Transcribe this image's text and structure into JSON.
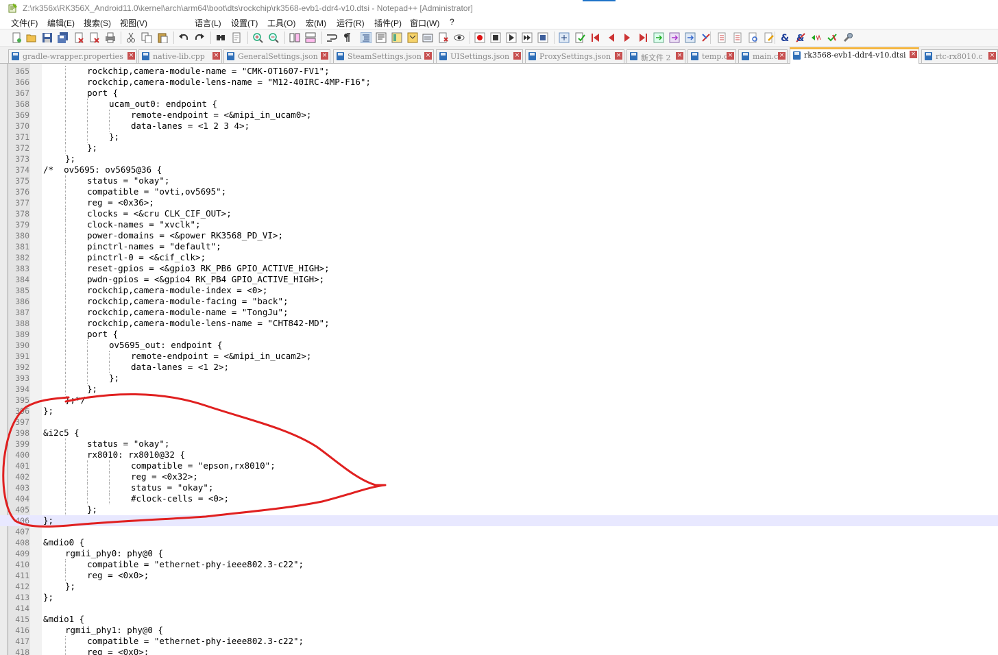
{
  "window": {
    "title": "Z:\\rk356x\\RK356X_Android11.0\\kernel\\arch\\arm64\\boot\\dts\\rockchip\\rk3568-evb1-ddr4-v10.dtsi - Notepad++ [Administrator]"
  },
  "menu": [
    "文件(F)",
    "编辑(E)",
    "搜索(S)",
    "视图(V)",
    "语言(L)",
    "设置(T)",
    "工具(O)",
    "宏(M)",
    "运行(R)",
    "插件(P)",
    "窗口(W)",
    "?"
  ],
  "toolbar": [
    {
      "name": "new-file-icon"
    },
    {
      "name": "open-file-icon"
    },
    {
      "name": "save-icon"
    },
    {
      "name": "save-all-icon"
    },
    {
      "name": "close-icon"
    },
    {
      "name": "close-all-icon"
    },
    {
      "name": "print-icon"
    },
    {
      "name": "cut-icon"
    },
    {
      "name": "copy-icon"
    },
    {
      "name": "paste-icon"
    },
    {
      "name": "undo-icon"
    },
    {
      "name": "redo-icon"
    },
    {
      "name": "find-icon"
    },
    {
      "name": "replace-icon"
    },
    {
      "name": "zoom-in-icon"
    },
    {
      "name": "zoom-out-icon"
    },
    {
      "name": "sync-vertical-icon"
    },
    {
      "name": "sync-horizontal-icon"
    },
    {
      "name": "word-wrap-icon"
    },
    {
      "name": "show-all-characters-icon"
    },
    {
      "name": "indent-guide-icon"
    },
    {
      "name": "user-language-icon"
    },
    {
      "name": "doc-map-icon"
    },
    {
      "name": "function-list-icon"
    },
    {
      "name": "folder-workspace-icon"
    },
    {
      "name": "monitoring-icon"
    },
    {
      "name": "eye-icon"
    },
    {
      "name": "macro-record-icon"
    },
    {
      "name": "macro-stop-icon"
    },
    {
      "name": "macro-play-icon"
    },
    {
      "name": "macro-run-multiple-icon"
    },
    {
      "name": "macro-save-icon"
    },
    {
      "name": "compare-icon"
    },
    {
      "name": "compare-check-icon"
    },
    {
      "name": "first-diff-icon"
    },
    {
      "name": "prev-diff-icon"
    },
    {
      "name": "next-diff-icon"
    },
    {
      "name": "last-diff-icon"
    },
    {
      "name": "diff-nav-1-icon"
    },
    {
      "name": "diff-nav-2-icon"
    },
    {
      "name": "diff-nav-3-icon"
    },
    {
      "name": "clear-compare-icon"
    },
    {
      "name": "document-icon"
    },
    {
      "name": "document-2-icon"
    },
    {
      "name": "document-search-icon"
    },
    {
      "name": "document-edit-icon"
    },
    {
      "name": "ampersand-icon"
    },
    {
      "name": "tools-icon"
    },
    {
      "name": "tag-prev-icon"
    },
    {
      "name": "tag-next-icon"
    },
    {
      "name": "settings-wrench-icon"
    }
  ],
  "tabs": [
    {
      "label": "gradle-wrapper.properties",
      "active": false
    },
    {
      "label": "native-lib.cpp",
      "active": false
    },
    {
      "label": "GeneralSettings.json",
      "active": false
    },
    {
      "label": "SteamSettings.json",
      "active": false
    },
    {
      "label": "UISettings.json",
      "active": false
    },
    {
      "label": "ProxySettings.json",
      "active": false
    },
    {
      "label": "新文件 2",
      "active": false
    },
    {
      "label": "temp.c",
      "active": false
    },
    {
      "label": "main.c",
      "active": false
    },
    {
      "label": "rk3568-evb1-ddr4-v10.dtsi",
      "active": true
    },
    {
      "label": "rtc-rx8010.c",
      "active": false
    }
  ],
  "editor": {
    "current_line": 406,
    "lines": [
      {
        "n": 365,
        "indent": 2,
        "text": "rockchip,camera-module-name = \"CMK-OT1607-FV1\";"
      },
      {
        "n": 366,
        "indent": 2,
        "text": "rockchip,camera-module-lens-name = \"M12-40IRC-4MP-F16\";"
      },
      {
        "n": 367,
        "indent": 2,
        "text": "port {"
      },
      {
        "n": 368,
        "indent": 3,
        "text": "ucam_out0: endpoint {"
      },
      {
        "n": 369,
        "indent": 4,
        "text": "remote-endpoint = <&mipi_in_ucam0>;"
      },
      {
        "n": 370,
        "indent": 4,
        "text": "data-lanes = <1 2 3 4>;"
      },
      {
        "n": 371,
        "indent": 3,
        "text": "};"
      },
      {
        "n": 372,
        "indent": 2,
        "text": "};"
      },
      {
        "n": 373,
        "indent": 1,
        "text": "};"
      },
      {
        "n": 374,
        "indent": 0,
        "text": "/*  ov5695: ov5695@36 {"
      },
      {
        "n": 375,
        "indent": 2,
        "text": "status = \"okay\";"
      },
      {
        "n": 376,
        "indent": 2,
        "text": "compatible = \"ovti,ov5695\";"
      },
      {
        "n": 377,
        "indent": 2,
        "text": "reg = <0x36>;"
      },
      {
        "n": 378,
        "indent": 2,
        "text": "clocks = <&cru CLK_CIF_OUT>;"
      },
      {
        "n": 379,
        "indent": 2,
        "text": "clock-names = \"xvclk\";"
      },
      {
        "n": 380,
        "indent": 2,
        "text": "power-domains = <&power RK3568_PD_VI>;"
      },
      {
        "n": 381,
        "indent": 2,
        "text": "pinctrl-names = \"default\";"
      },
      {
        "n": 382,
        "indent": 2,
        "text": "pinctrl-0 = <&cif_clk>;"
      },
      {
        "n": 383,
        "indent": 2,
        "text": "reset-gpios = <&gpio3 RK_PB6 GPIO_ACTIVE_HIGH>;"
      },
      {
        "n": 384,
        "indent": 2,
        "text": "pwdn-gpios = <&gpio4 RK_PB4 GPIO_ACTIVE_HIGH>;"
      },
      {
        "n": 385,
        "indent": 2,
        "text": "rockchip,camera-module-index = <0>;"
      },
      {
        "n": 386,
        "indent": 2,
        "text": "rockchip,camera-module-facing = \"back\";"
      },
      {
        "n": 387,
        "indent": 2,
        "text": "rockchip,camera-module-name = \"TongJu\";"
      },
      {
        "n": 388,
        "indent": 2,
        "text": "rockchip,camera-module-lens-name = \"CHT842-MD\";"
      },
      {
        "n": 389,
        "indent": 2,
        "text": "port {"
      },
      {
        "n": 390,
        "indent": 3,
        "text": "ov5695_out: endpoint {"
      },
      {
        "n": 391,
        "indent": 4,
        "text": "remote-endpoint = <&mipi_in_ucam2>;"
      },
      {
        "n": 392,
        "indent": 4,
        "text": "data-lanes = <1 2>;"
      },
      {
        "n": 393,
        "indent": 3,
        "text": "};"
      },
      {
        "n": 394,
        "indent": 2,
        "text": "};"
      },
      {
        "n": 395,
        "indent": 1,
        "text": "};*/"
      },
      {
        "n": 396,
        "indent": 0,
        "text": "};"
      },
      {
        "n": 397,
        "indent": 0,
        "text": ""
      },
      {
        "n": 398,
        "indent": 0,
        "text": "&i2c5 {"
      },
      {
        "n": 399,
        "indent": 2,
        "text": "status = \"okay\";"
      },
      {
        "n": 400,
        "indent": 2,
        "text": "rx8010: rx8010@32 {"
      },
      {
        "n": 401,
        "indent": 4,
        "text": "compatible = \"epson,rx8010\";"
      },
      {
        "n": 402,
        "indent": 4,
        "text": "reg = <0x32>;"
      },
      {
        "n": 403,
        "indent": 4,
        "text": "status = \"okay\";"
      },
      {
        "n": 404,
        "indent": 4,
        "text": "#clock-cells = <0>;"
      },
      {
        "n": 405,
        "indent": 2,
        "text": "};"
      },
      {
        "n": 406,
        "indent": 0,
        "text": "};"
      },
      {
        "n": 407,
        "indent": 0,
        "text": ""
      },
      {
        "n": 408,
        "indent": 0,
        "text": "&mdio0 {"
      },
      {
        "n": 409,
        "indent": 1,
        "text": "rgmii_phy0: phy@0 {"
      },
      {
        "n": 410,
        "indent": 2,
        "text": "compatible = \"ethernet-phy-ieee802.3-c22\";"
      },
      {
        "n": 411,
        "indent": 2,
        "text": "reg = <0x0>;"
      },
      {
        "n": 412,
        "indent": 1,
        "text": "};"
      },
      {
        "n": 413,
        "indent": 0,
        "text": "};"
      },
      {
        "n": 414,
        "indent": 0,
        "text": ""
      },
      {
        "n": 415,
        "indent": 0,
        "text": "&mdio1 {"
      },
      {
        "n": 416,
        "indent": 1,
        "text": "rgmii_phy1: phy@0 {"
      },
      {
        "n": 417,
        "indent": 2,
        "text": "compatible = \"ethernet-phy-ieee802.3-c22\";"
      },
      {
        "n": 418,
        "indent": 2,
        "text": "reg = <0x0>;"
      }
    ]
  },
  "colors": {
    "annotation": "#e02020",
    "current_line": "#e8e8ff",
    "active_tab_accent": "#f4b53f"
  }
}
